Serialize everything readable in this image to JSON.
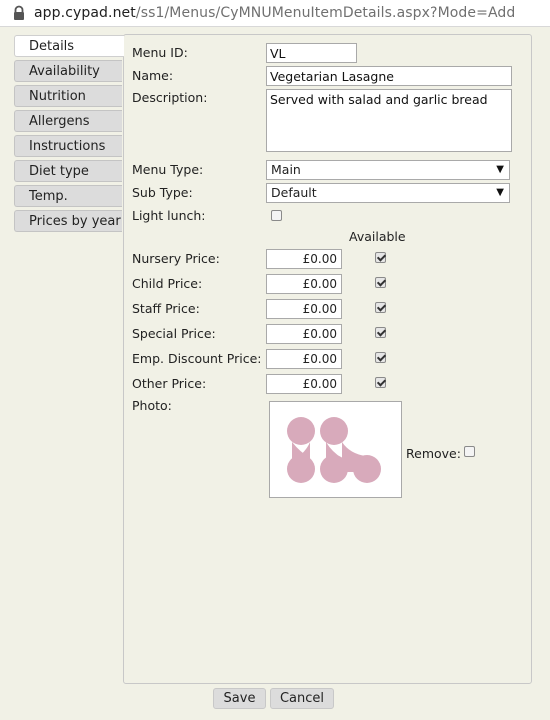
{
  "browser": {
    "url_host": "app.cypad.net",
    "url_path": "/ss1/Menus/CyMNUMenuItemDetails.aspx?Mode=Add"
  },
  "tabs": [
    {
      "label": "Details",
      "active": true
    },
    {
      "label": "Availability"
    },
    {
      "label": "Nutrition"
    },
    {
      "label": "Allergens"
    },
    {
      "label": "Instructions"
    },
    {
      "label": "Diet type"
    },
    {
      "label": "Temp."
    },
    {
      "label": "Prices by year"
    }
  ],
  "form": {
    "menu_id_label": "Menu ID:",
    "menu_id_value": "VL",
    "name_label": "Name:",
    "name_value": "Vegetarian Lasagne",
    "description_label": "Description:",
    "description_value": "Served with salad and garlic bread",
    "menu_type_label": "Menu Type:",
    "menu_type_value": "Main",
    "sub_type_label": "Sub Type:",
    "sub_type_value": "Default",
    "light_lunch_label": "Light lunch:",
    "light_lunch_checked": false,
    "available_header": "Available",
    "prices": [
      {
        "label": "Nursery Price:",
        "value": "£0.00",
        "available": true
      },
      {
        "label": "Child Price:",
        "value": "£0.00",
        "available": true
      },
      {
        "label": "Staff Price:",
        "value": "£0.00",
        "available": true
      },
      {
        "label": "Special Price:",
        "value": "£0.00",
        "available": true
      },
      {
        "label": "Emp. Discount Price:",
        "value": "£0.00",
        "available": true
      },
      {
        "label": "Other Price:",
        "value": "£0.00",
        "available": true
      }
    ],
    "photo_label": "Photo:",
    "remove_label": "Remove:",
    "remove_checked": false
  },
  "buttons": {
    "save": "Save",
    "cancel": "Cancel"
  },
  "colors": {
    "background": "#f1f1e6",
    "logo": "#d8aabb",
    "tab": "#dcdcdc"
  }
}
